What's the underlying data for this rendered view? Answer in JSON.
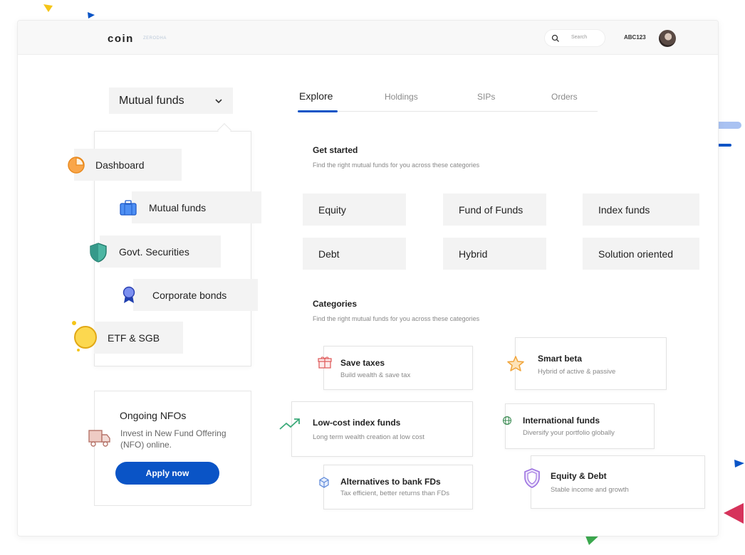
{
  "header": {
    "logo": "coin",
    "logo_sub": "ZERODHA",
    "search_placeholder": "Search",
    "user_id": "ABC123"
  },
  "product_selector": {
    "label": "Mutual funds"
  },
  "menu": {
    "items": [
      {
        "label": "Dashboard",
        "icon": "pie-chart-icon"
      },
      {
        "label": "Mutual funds",
        "icon": "briefcase-icon"
      },
      {
        "label": "Govt. Securities",
        "icon": "shield-icon"
      },
      {
        "label": "Corporate bonds",
        "icon": "badge-icon"
      },
      {
        "label": "ETF & SGB",
        "icon": "coin-icon"
      }
    ]
  },
  "nfo": {
    "title": "Ongoing NFOs",
    "description": "Invest in New Fund Offering (NFO) online.",
    "button": "Apply now"
  },
  "tabs": [
    {
      "label": "Explore",
      "active": true
    },
    {
      "label": "Holdings",
      "active": false
    },
    {
      "label": "SIPs",
      "active": false
    },
    {
      "label": "Orders",
      "active": false
    }
  ],
  "get_started": {
    "title": "Get started",
    "subtitle": "Find the right mutual funds for you across these categories",
    "chips": [
      "Equity",
      "Fund of Funds",
      "Index funds",
      "Debt",
      "Hybrid",
      "Solution oriented"
    ]
  },
  "categories": {
    "title": "Categories",
    "subtitle": "Find the right mutual funds for you across these categories",
    "items": [
      {
        "title": "Save taxes",
        "desc": "Build wealth & save tax",
        "icon": "gift-icon"
      },
      {
        "title": "Smart beta",
        "desc": "Hybrid of active & passive",
        "icon": "star-icon"
      },
      {
        "title": "Low-cost index funds",
        "desc": "Long term wealth creation at low cost",
        "icon": "trend-up-icon"
      },
      {
        "title": "International funds",
        "desc": "Diversify your portfolio globally",
        "icon": "globe-icon"
      },
      {
        "title": "Alternatives to bank FDs",
        "desc": "Tax efficient, better returns than FDs",
        "icon": "cube-icon"
      },
      {
        "title": "Equity & Debt",
        "desc": "Stable income and growth",
        "icon": "shield-icon"
      }
    ]
  },
  "colors": {
    "accent": "#0a54c6",
    "chip_bg": "#f3f3f3",
    "confetti_yellow": "#f5c518",
    "confetti_blue": "#0a54c6",
    "confetti_red": "#d6335b",
    "confetti_green": "#3caa4f"
  }
}
